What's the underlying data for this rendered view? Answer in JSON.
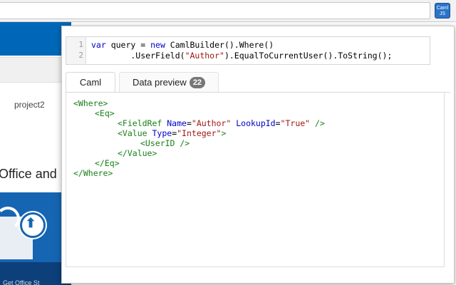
{
  "browser": {
    "extension_icon_line1": "Caml",
    "extension_icon_line2": "JS"
  },
  "background_page": {
    "project_label": "project2",
    "office_heading": "Office and",
    "promo_caption": "Get Office St"
  },
  "editor": {
    "lines": [
      {
        "number": "1",
        "text": "var query = new CamlBuilder().Where()"
      },
      {
        "number": "2",
        "text": "        .UserField(\"Author\").EqualToCurrentUser().ToString();"
      }
    ]
  },
  "tabs": [
    {
      "label": "Caml",
      "active": true
    },
    {
      "label": "Data preview",
      "badge": "22",
      "active": false
    }
  ],
  "caml_output": {
    "where_open": "<Where>",
    "eq_open": "<Eq>",
    "fieldref": {
      "tag": "<FieldRef",
      "attr1": "Name",
      "val1": "\"Author\"",
      "attr2": "LookupId",
      "val2": "\"True\"",
      "close": "/>"
    },
    "value_open": {
      "tag": "<Value",
      "attr": "Type",
      "val": "\"Integer\"",
      "close": ">"
    },
    "userid": "<UserID />",
    "value_close": "</Value>",
    "eq_close": "</Eq>",
    "where_close": "</Where>"
  },
  "colors": {
    "accent_blue": "#0067b8",
    "xml_tag": "#1a7f1a",
    "xml_attr": "#0000c8",
    "xml_value": "#a31515"
  }
}
